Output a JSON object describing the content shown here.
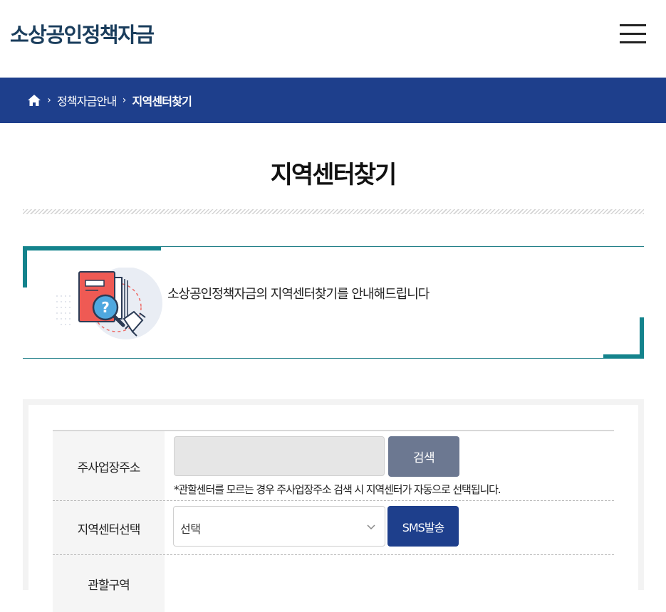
{
  "header": {
    "logo_text": "소상공인정책자금",
    "menu_icon": "hamburger-menu-icon"
  },
  "breadcrumb": {
    "home_icon": "home-icon",
    "items": [
      "정책자금안내",
      "지역센터찾기"
    ]
  },
  "page": {
    "title": "지역센터찾기",
    "intro_text": "소상공인정책자금의 지역센터찾기를 안내해드립니다"
  },
  "form": {
    "address": {
      "label": "주사업장주소",
      "input_value": "",
      "search_button": "검색",
      "note": "*관할센터를 모르는 경우 주사업장주소 검색 시 지역센터가 자동으로 선택됩니다."
    },
    "center": {
      "label": "지역센터선택",
      "selected": "선택",
      "sms_button": "SMS발송"
    },
    "jurisdiction": {
      "label": "관할구역"
    }
  },
  "colors": {
    "primary_navy": "#1e3f8c",
    "teal_accent": "#14838c",
    "logo_color": "#1a3d5c",
    "search_button": "#6c7891"
  }
}
